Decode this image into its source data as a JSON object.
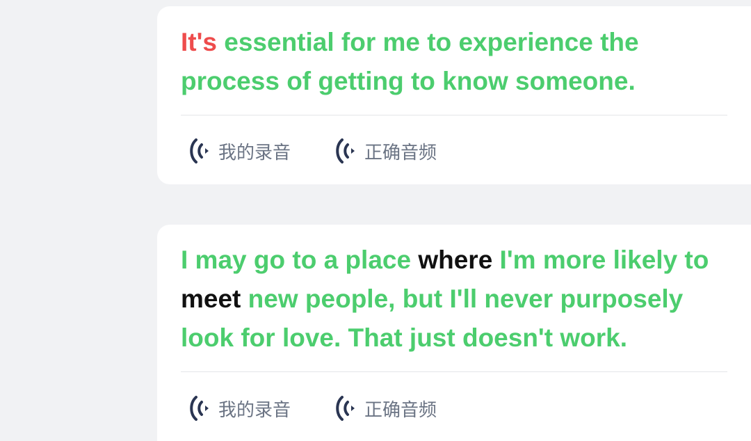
{
  "cards": [
    {
      "segments": [
        {
          "text": "It's",
          "color": "#ee4c4c"
        },
        {
          "text": " essential for me to experience the process of getting to know someone.",
          "color": "#4ccd6e"
        }
      ],
      "actions": {
        "my_recording": "我的录音",
        "correct_audio": "正确音频"
      }
    },
    {
      "segments": [
        {
          "text": "I may go to a place ",
          "color": "#4ccd6e"
        },
        {
          "text": "where",
          "color": "#111111"
        },
        {
          "text": " I'm more likely to ",
          "color": "#4ccd6e"
        },
        {
          "text": "meet",
          "color": "#111111"
        },
        {
          "text": " new people, but I'll never purposely look for love. That just doesn't work.",
          "color": "#4ccd6e"
        }
      ],
      "actions": {
        "my_recording": "我的录音",
        "correct_audio": "正确音频"
      }
    }
  ],
  "colors": {
    "background": "#f1f2f4",
    "card": "#ffffff",
    "correct": "#4ccd6e",
    "incorrect": "#ee4c4c",
    "unscored": "#111111",
    "icon": "#2a3552",
    "label": "#6b7484"
  },
  "icons": {
    "audio": "sound-wave-icon"
  }
}
